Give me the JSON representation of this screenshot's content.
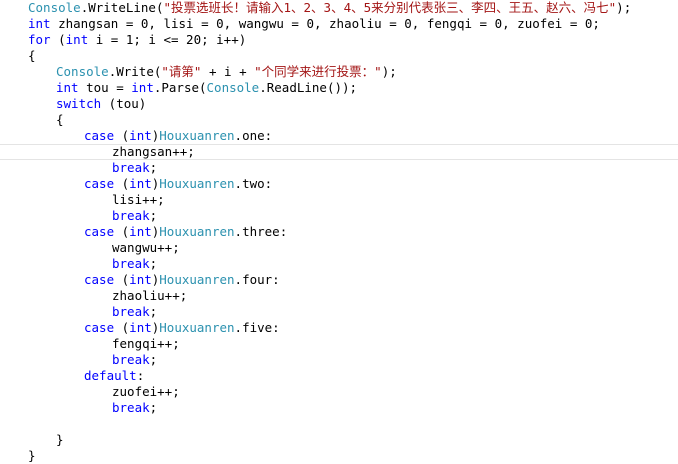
{
  "editor": {
    "lines": [
      {
        "indent": 0,
        "tokens": [
          {
            "t": "Console",
            "c": "typ"
          },
          {
            "t": ".WriteLine(",
            "c": "pln"
          },
          {
            "t": "\"投票选班长！请输入1、2、3、4、5来分别代表张三、李四、王五、赵六、冯七\"",
            "c": "str"
          },
          {
            "t": ");",
            "c": "pln"
          }
        ]
      },
      {
        "indent": 0,
        "tokens": [
          {
            "t": "int",
            "c": "kw"
          },
          {
            "t": " zhangsan = 0, lisi = 0, wangwu = 0, zhaoliu = 0, fengqi = 0, zuofei = 0;",
            "c": "pln"
          }
        ]
      },
      {
        "indent": 0,
        "tokens": [
          {
            "t": "for",
            "c": "kw"
          },
          {
            "t": " (",
            "c": "pln"
          },
          {
            "t": "int",
            "c": "kw"
          },
          {
            "t": " i = 1; i <= 20; i++)",
            "c": "pln"
          }
        ]
      },
      {
        "indent": 0,
        "tokens": [
          {
            "t": "{",
            "c": "pln"
          }
        ]
      },
      {
        "indent": 1,
        "tokens": [
          {
            "t": "Console",
            "c": "typ"
          },
          {
            "t": ".Write(",
            "c": "pln"
          },
          {
            "t": "\"请第\"",
            "c": "str"
          },
          {
            "t": " + i + ",
            "c": "pln"
          },
          {
            "t": "\"个同学来进行投票：\"",
            "c": "str"
          },
          {
            "t": ");",
            "c": "pln"
          }
        ]
      },
      {
        "indent": 1,
        "tokens": [
          {
            "t": "int",
            "c": "kw"
          },
          {
            "t": " tou = ",
            "c": "pln"
          },
          {
            "t": "int",
            "c": "kw"
          },
          {
            "t": ".Parse(",
            "c": "pln"
          },
          {
            "t": "Console",
            "c": "typ"
          },
          {
            "t": ".ReadLine());",
            "c": "pln"
          }
        ]
      },
      {
        "indent": 1,
        "tokens": [
          {
            "t": "switch",
            "c": "kw"
          },
          {
            "t": " (tou)",
            "c": "pln"
          }
        ]
      },
      {
        "indent": 1,
        "tokens": [
          {
            "t": "{",
            "c": "pln"
          }
        ]
      },
      {
        "indent": 2,
        "tokens": [
          {
            "t": "case",
            "c": "kw"
          },
          {
            "t": " (",
            "c": "pln"
          },
          {
            "t": "int",
            "c": "kw"
          },
          {
            "t": ")",
            "c": "pln"
          },
          {
            "t": "Houxuanren",
            "c": "typ"
          },
          {
            "t": ".one:",
            "c": "pln"
          }
        ]
      },
      {
        "indent": 3,
        "current": true,
        "tokens": [
          {
            "t": "zhangsan++;",
            "c": "pln"
          }
        ]
      },
      {
        "indent": 3,
        "tokens": [
          {
            "t": "break",
            "c": "kw"
          },
          {
            "t": ";",
            "c": "pln"
          }
        ]
      },
      {
        "indent": 2,
        "tokens": [
          {
            "t": "case",
            "c": "kw"
          },
          {
            "t": " (",
            "c": "pln"
          },
          {
            "t": "int",
            "c": "kw"
          },
          {
            "t": ")",
            "c": "pln"
          },
          {
            "t": "Houxuanren",
            "c": "typ"
          },
          {
            "t": ".two:",
            "c": "pln"
          }
        ]
      },
      {
        "indent": 3,
        "tokens": [
          {
            "t": "lisi++;",
            "c": "pln"
          }
        ]
      },
      {
        "indent": 3,
        "tokens": [
          {
            "t": "break",
            "c": "kw"
          },
          {
            "t": ";",
            "c": "pln"
          }
        ]
      },
      {
        "indent": 2,
        "tokens": [
          {
            "t": "case",
            "c": "kw"
          },
          {
            "t": " (",
            "c": "pln"
          },
          {
            "t": "int",
            "c": "kw"
          },
          {
            "t": ")",
            "c": "pln"
          },
          {
            "t": "Houxuanren",
            "c": "typ"
          },
          {
            "t": ".three:",
            "c": "pln"
          }
        ]
      },
      {
        "indent": 3,
        "tokens": [
          {
            "t": "wangwu++;",
            "c": "pln"
          }
        ]
      },
      {
        "indent": 3,
        "tokens": [
          {
            "t": "break",
            "c": "kw"
          },
          {
            "t": ";",
            "c": "pln"
          }
        ]
      },
      {
        "indent": 2,
        "tokens": [
          {
            "t": "case",
            "c": "kw"
          },
          {
            "t": " (",
            "c": "pln"
          },
          {
            "t": "int",
            "c": "kw"
          },
          {
            "t": ")",
            "c": "pln"
          },
          {
            "t": "Houxuanren",
            "c": "typ"
          },
          {
            "t": ".four:",
            "c": "pln"
          }
        ]
      },
      {
        "indent": 3,
        "tokens": [
          {
            "t": "zhaoliu++;",
            "c": "pln"
          }
        ]
      },
      {
        "indent": 3,
        "tokens": [
          {
            "t": "break",
            "c": "kw"
          },
          {
            "t": ";",
            "c": "pln"
          }
        ]
      },
      {
        "indent": 2,
        "tokens": [
          {
            "t": "case",
            "c": "kw"
          },
          {
            "t": " (",
            "c": "pln"
          },
          {
            "t": "int",
            "c": "kw"
          },
          {
            "t": ")",
            "c": "pln"
          },
          {
            "t": "Houxuanren",
            "c": "typ"
          },
          {
            "t": ".five:",
            "c": "pln"
          }
        ]
      },
      {
        "indent": 3,
        "tokens": [
          {
            "t": "fengqi++;",
            "c": "pln"
          }
        ]
      },
      {
        "indent": 3,
        "tokens": [
          {
            "t": "break",
            "c": "kw"
          },
          {
            "t": ";",
            "c": "pln"
          }
        ]
      },
      {
        "indent": 2,
        "tokens": [
          {
            "t": "default",
            "c": "kw"
          },
          {
            "t": ":",
            "c": "pln"
          }
        ]
      },
      {
        "indent": 3,
        "tokens": [
          {
            "t": "zuofei++;",
            "c": "pln"
          }
        ]
      },
      {
        "indent": 3,
        "tokens": [
          {
            "t": "break",
            "c": "kw"
          },
          {
            "t": ";",
            "c": "pln"
          }
        ]
      },
      {
        "indent": 0,
        "tokens": []
      },
      {
        "indent": 1,
        "tokens": [
          {
            "t": "}",
            "c": "pln"
          }
        ]
      },
      {
        "indent": 0,
        "tokens": [
          {
            "t": "}",
            "c": "pln"
          }
        ]
      }
    ]
  },
  "colors": {
    "background": "#ffffff",
    "keyword": "#0000ff",
    "type": "#2b91af",
    "string": "#a31515",
    "plain": "#000000",
    "current_line_border": "#e4e4e4"
  }
}
